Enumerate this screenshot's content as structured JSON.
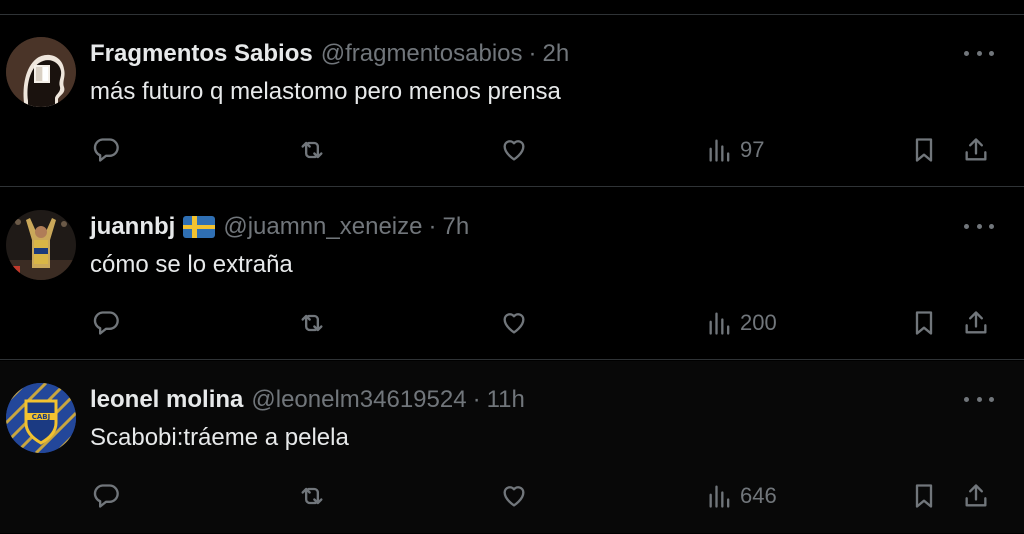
{
  "tweets": [
    {
      "name": "Fragmentos Sabios",
      "handle": "@fragmentosabios",
      "separator": "·",
      "time": "2h",
      "text": "más futuro q melastomo pero menos prensa",
      "views": "97",
      "avatar_icon": "profile-silhouette-window-icon"
    },
    {
      "name": "juannbj",
      "flag": "swedish-flag-icon",
      "handle": "@juamnn_xeneize",
      "separator": "·",
      "time": "7h",
      "text": "cómo se lo extraña",
      "views": "200",
      "avatar_icon": "football-player-photo"
    },
    {
      "name": "leonel molina",
      "handle": "@leonelm34619524",
      "separator": "·",
      "time": "11h",
      "text": "Scabobi:tráeme a pelela",
      "views": "646",
      "avatar_icon": "cabj-crest-logo"
    }
  ],
  "colors": {
    "background": "#000000",
    "text": "#e7e9ea",
    "secondary": "#71767b",
    "divider": "#2f3336"
  }
}
